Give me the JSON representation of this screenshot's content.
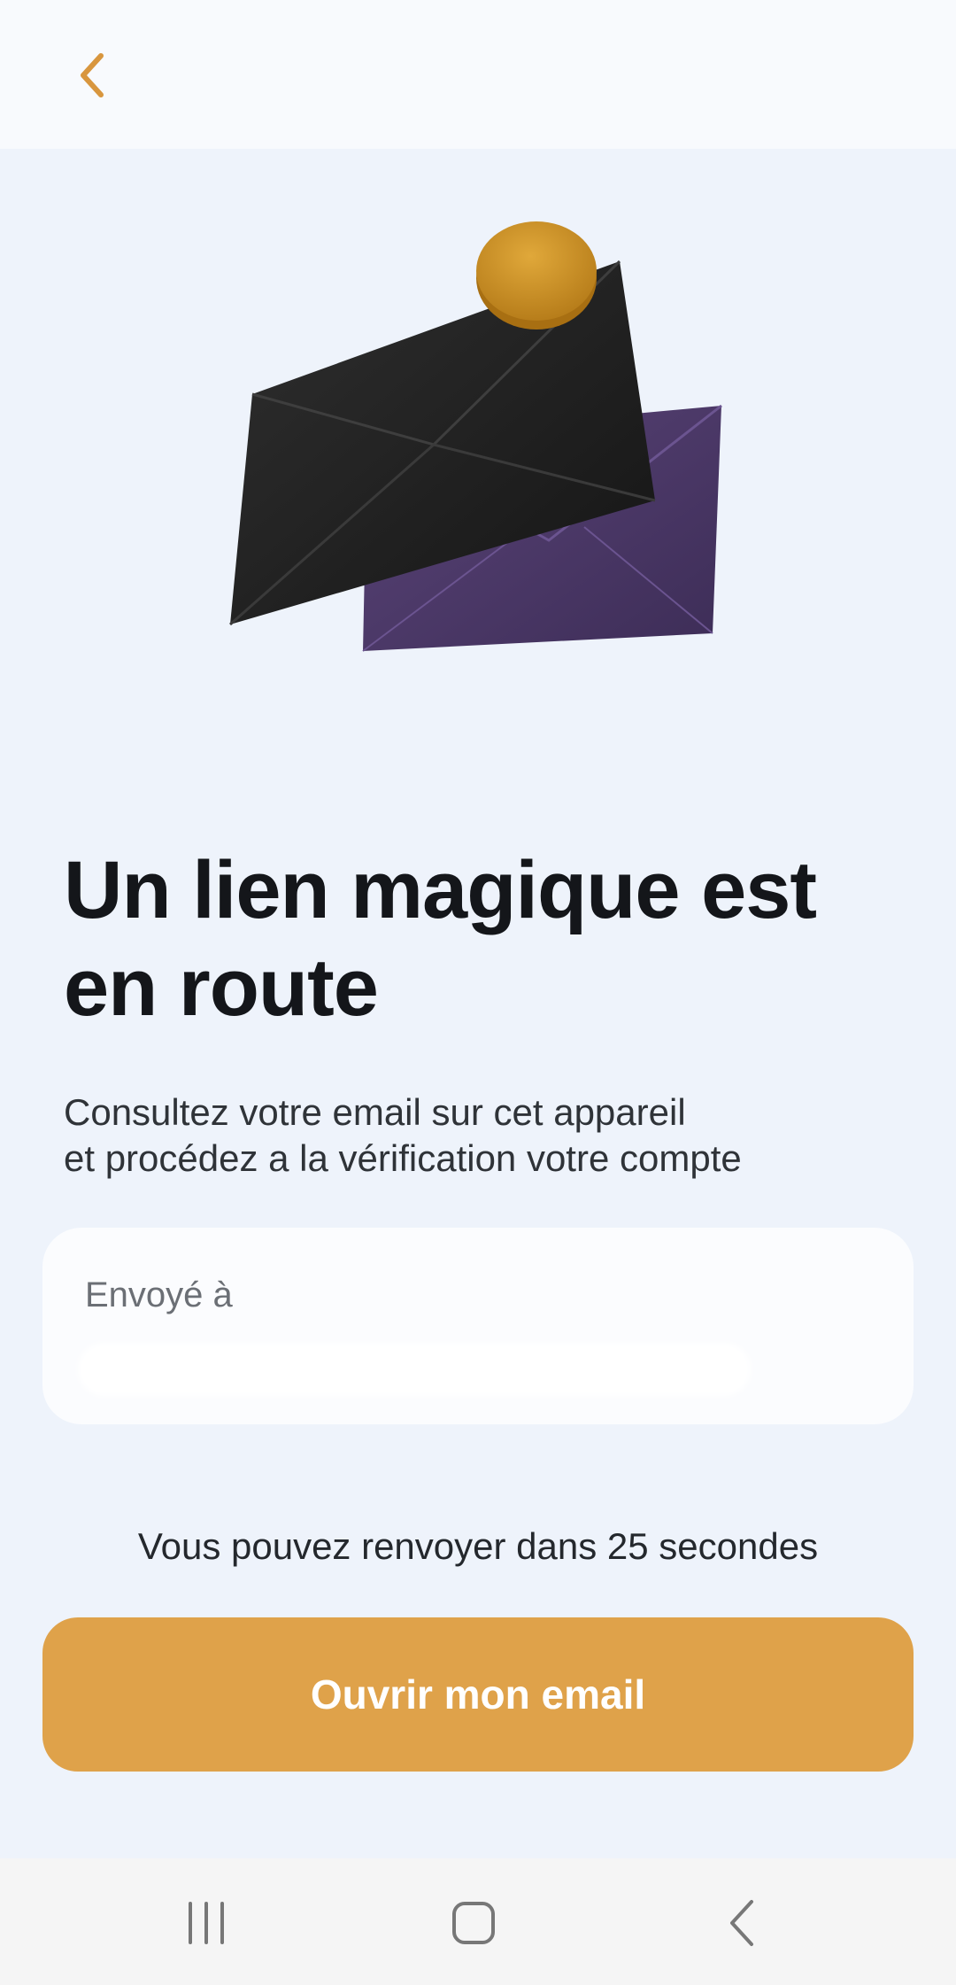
{
  "header": {
    "back_icon": "chevron-left-icon",
    "accent_color": "#D8963E"
  },
  "illustration": {
    "icon": "envelopes-with-coin-illustration"
  },
  "main": {
    "title": "Un lien magique est en route",
    "subtitle_line1": "Consultez votre email sur cet appareil",
    "subtitle_line2": "et procédez a la vérification votre compte",
    "sent_to_label": "Envoyé à",
    "resend_text": "Vous pouvez renvoyer dans 25 secondes",
    "open_email_label": "Ouvrir mon email",
    "button_color": "#DFA24A"
  },
  "system_nav": {
    "recents_icon": "recents-icon",
    "home_icon": "home-icon",
    "back_icon": "back-icon"
  }
}
